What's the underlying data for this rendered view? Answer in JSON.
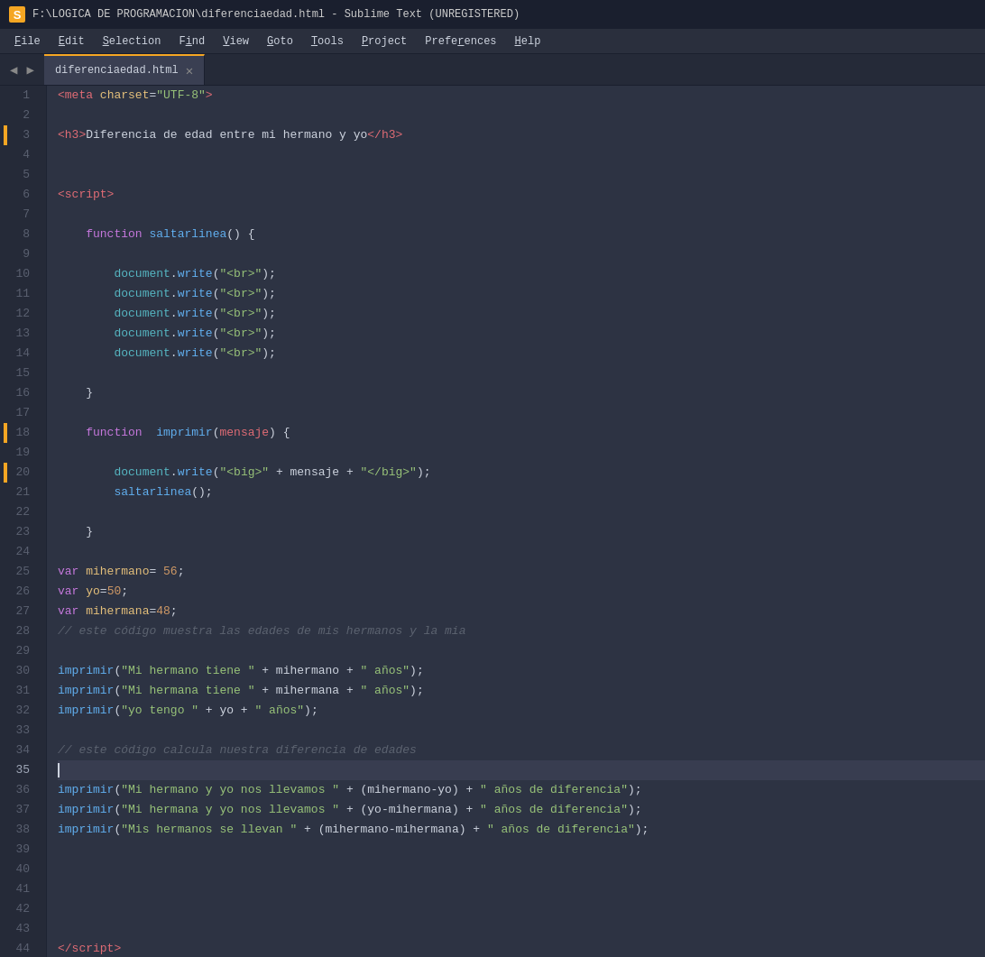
{
  "titleBar": {
    "title": "F:\\LOGICA DE PROGRAMACION\\diferenciaedad.html - Sublime Text (UNREGISTERED)"
  },
  "menuBar": {
    "items": [
      {
        "label": "File",
        "underline": "F"
      },
      {
        "label": "Edit",
        "underline": "E"
      },
      {
        "label": "Selection",
        "underline": "S"
      },
      {
        "label": "Find",
        "underline": "i"
      },
      {
        "label": "View",
        "underline": "V"
      },
      {
        "label": "Goto",
        "underline": "G"
      },
      {
        "label": "Tools",
        "underline": "T"
      },
      {
        "label": "Project",
        "underline": "P"
      },
      {
        "label": "Preferences",
        "underline": "r"
      },
      {
        "label": "Help",
        "underline": "H"
      }
    ]
  },
  "tabBar": {
    "activeTab": "diferenciaedad.html"
  },
  "colors": {
    "accent": "#f5a623",
    "bg": "#2d3343",
    "gutterBg": "#252a38",
    "tabActiveBg": "#3a3f52"
  }
}
